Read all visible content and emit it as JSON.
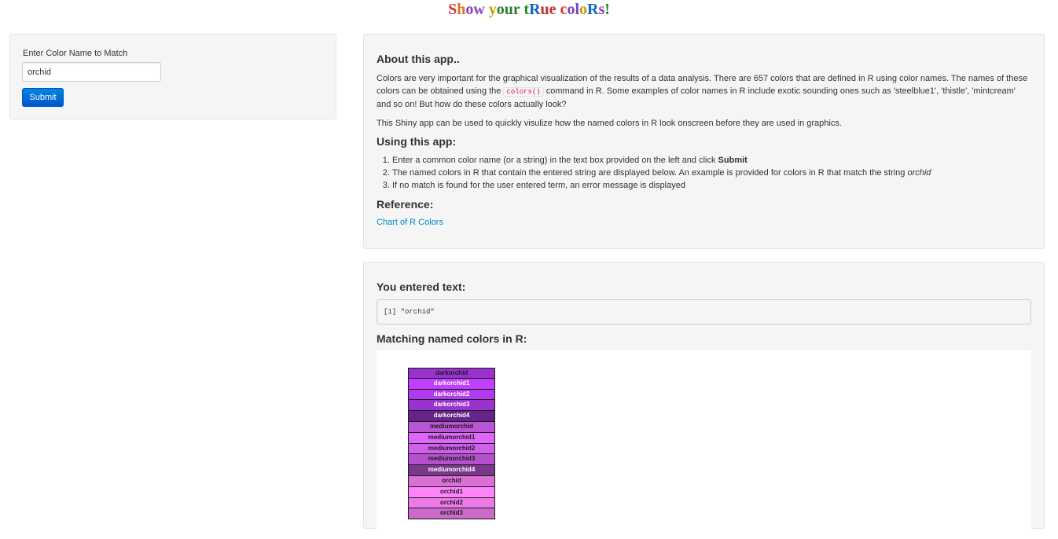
{
  "title": {
    "segments": [
      {
        "text": "S",
        "color": "#e03030"
      },
      {
        "text": "h",
        "color": "#e07020"
      },
      {
        "text": "ow",
        "color": "#8a3fc0"
      },
      {
        "text": " ",
        "color": "#000000"
      },
      {
        "text": "y",
        "color": "#c8a000"
      },
      {
        "text": "our",
        "color": "#2e7d32"
      },
      {
        "text": " ",
        "color": "#000000"
      },
      {
        "text": "t",
        "color": "#1a8a1a"
      },
      {
        "text": "R",
        "color": "#1565c0"
      },
      {
        "text": "ue",
        "color": "#c0302a"
      },
      {
        "text": " ",
        "color": "#000000"
      },
      {
        "text": "c",
        "color": "#e03030"
      },
      {
        "text": "ol",
        "color": "#7b3fc0"
      },
      {
        "text": "o",
        "color": "#c8a000"
      },
      {
        "text": "R",
        "color": "#1565c0"
      },
      {
        "text": "s",
        "color": "#8a3fc0"
      },
      {
        "text": "!",
        "color": "#1a8a1a"
      }
    ]
  },
  "sidebar": {
    "input_label": "Enter Color Name to Match",
    "input_value": "orchid",
    "submit_label": "Submit"
  },
  "about": {
    "heading": "About this app..",
    "para1_before": "Colors are very important for the graphical visualization of the results of a data analysis. There are 657 colors that are defined in R using color names. The names of these colors can be obtained using the ",
    "para1_code": "colors()",
    "para1_after": " command in R. Some examples of color names in R include exotic sounding ones such as 'steelblue1', 'thistle', 'mintcream' and so on! But how do these colors actually look?",
    "para2": "This Shiny app can be used to quickly visulize how the named colors in R look onscreen before they are used in graphics.",
    "using_heading": "Using this app:",
    "step1_text": "Enter a common color name (or a string) in the text box provided on the left and click ",
    "step1_bold": "Submit",
    "step2_text": "The named colors in R that contain the entered string are displayed below. An example is provided for colors in R that match the string ",
    "step2_italic": "orchid",
    "step3_text": "If no match is found for the user entered term, an error message is displayed",
    "reference_heading": "Reference:",
    "reference_link": "Chart of R Colors"
  },
  "output": {
    "entered_heading": "You entered text:",
    "entered_value": "[1] \"orchid\"",
    "matching_heading": "Matching named colors in R:",
    "swatches": [
      {
        "name": "darkorchid",
        "color": "#9932CC",
        "text_color": "#1a1a1a"
      },
      {
        "name": "darkorchid1",
        "color": "#BF3EFF",
        "text_color": "#ffffff"
      },
      {
        "name": "darkorchid2",
        "color": "#B23AEE",
        "text_color": "#ffffff"
      },
      {
        "name": "darkorchid3",
        "color": "#9A32CD",
        "text_color": "#ffffff"
      },
      {
        "name": "darkorchid4",
        "color": "#68228B",
        "text_color": "#ffffff"
      },
      {
        "name": "mediumorchid",
        "color": "#BA55D3",
        "text_color": "#1a1a1a"
      },
      {
        "name": "mediumorchid1",
        "color": "#E066FF",
        "text_color": "#1a1a1a"
      },
      {
        "name": "mediumorchid2",
        "color": "#D15FEE",
        "text_color": "#1a1a1a"
      },
      {
        "name": "mediumorchid3",
        "color": "#B452CD",
        "text_color": "#1a1a1a"
      },
      {
        "name": "mediumorchid4",
        "color": "#7A378B",
        "text_color": "#ffffff"
      },
      {
        "name": "orchid",
        "color": "#DA70D6",
        "text_color": "#1a1a1a"
      },
      {
        "name": "orchid1",
        "color": "#FF83FA",
        "text_color": "#1a1a1a"
      },
      {
        "name": "orchid2",
        "color": "#EE7AE9",
        "text_color": "#1a1a1a"
      },
      {
        "name": "orchid3",
        "color": "#CD69C9",
        "text_color": "#1a1a1a"
      }
    ]
  }
}
